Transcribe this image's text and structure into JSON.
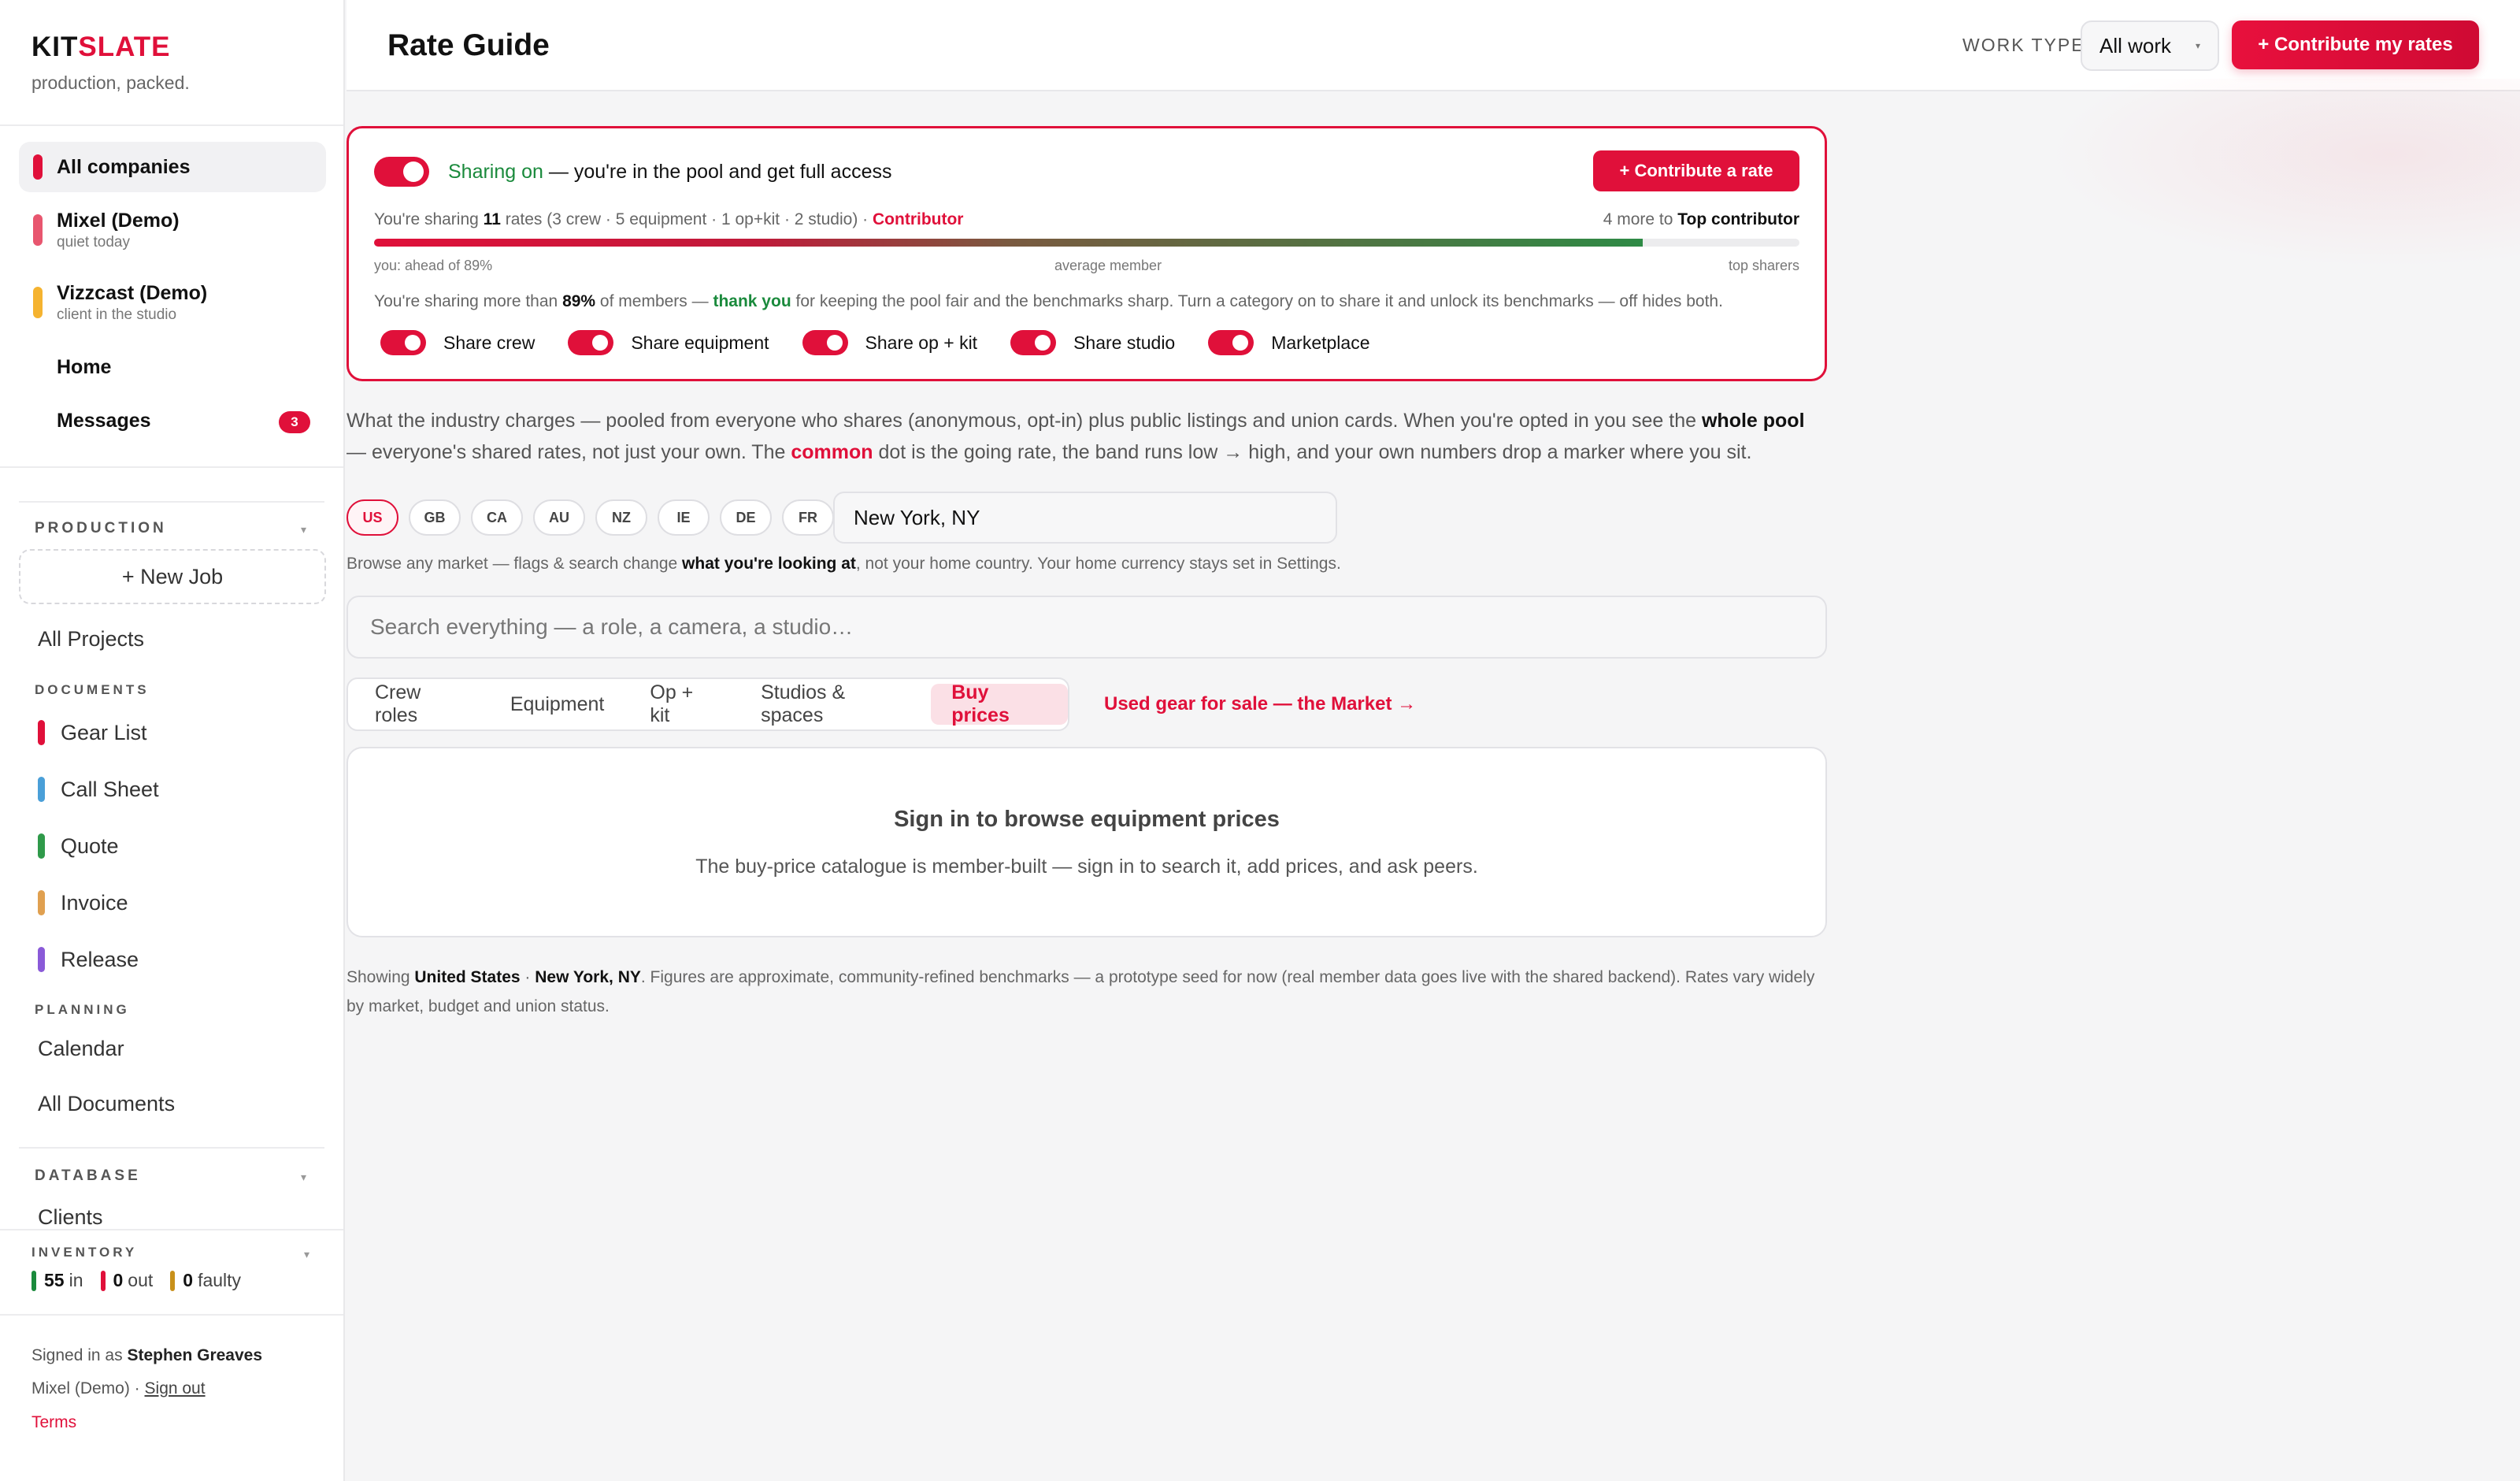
{
  "brand": {
    "kit": "KIT",
    "slate": "SLATE",
    "tagline": "production, packed."
  },
  "companies": [
    {
      "name": "All companies",
      "sub": "",
      "color": "#e0103a"
    },
    {
      "name": "Mixel (Demo)",
      "sub": "quiet today",
      "color": "#e8566f"
    },
    {
      "name": "Vizzcast (Demo)",
      "sub": "client in the studio",
      "color": "#f5b330"
    }
  ],
  "nav": {
    "home": "Home",
    "messages": "Messages",
    "messages_badge": "3"
  },
  "sections": {
    "production": "PRODUCTION",
    "new_job": "+ New Job",
    "all_projects": "All Projects",
    "documents": "DOCUMENTS",
    "planning": "PLANNING",
    "calendar": "Calendar",
    "all_documents": "All Documents",
    "database": "DATABASE",
    "clients": "Clients",
    "inventory": "INVENTORY"
  },
  "documents": [
    {
      "label": "Gear List",
      "color": "#e0103a"
    },
    {
      "label": "Call Sheet",
      "color": "#4a9fd8"
    },
    {
      "label": "Quote",
      "color": "#2f9a4a"
    },
    {
      "label": "Invoice",
      "color": "#e0a050"
    },
    {
      "label": "Release",
      "color": "#8a5ad8"
    }
  ],
  "inventory": {
    "in_count": "55",
    "in_label": "in",
    "in_color": "#1a8a3c",
    "out_count": "0",
    "out_label": "out",
    "out_color": "#e0103a",
    "faulty_count": "0",
    "faulty_label": "faulty",
    "faulty_color": "#c8901a"
  },
  "account": {
    "signed_prefix": "Signed in as",
    "user": "Stephen Greaves",
    "company": "Mixel (Demo)",
    "sep": " · ",
    "sign_out": "Sign out",
    "terms": "Terms"
  },
  "header": {
    "title": "Rate Guide",
    "work_type_label": "WORK TYPE",
    "work_type_value": "All work",
    "contribute_button": "+ Contribute my rates"
  },
  "sharing": {
    "status": "Sharing on",
    "status_rest": " — you're in the pool and get full access",
    "contribute_rate": "+ Contribute a rate",
    "sharing_prefix": "You're sharing ",
    "rates_count": "11",
    "sharing_detail": " rates (3 crew · 5 equipment · 1 op+kit · 2 studio) · ",
    "tier": "Contributor",
    "more_prefix": "4 more to ",
    "next_tier": "Top contributor",
    "progress_fraction": 0.89,
    "label_you": "you: ahead of 89%",
    "label_avg": "average member",
    "label_top": "top sharers",
    "note_prefix": "You're sharing more than ",
    "note_pct": "89%",
    "note_mid": " of members — ",
    "note_thanks": "thank you",
    "note_rest": " for keeping the pool fair and the benchmarks sharp. Turn a category on to share it and unlock its benchmarks — off hides both.",
    "toggles": [
      {
        "label": "Share crew",
        "on": true
      },
      {
        "label": "Share equipment",
        "on": true
      },
      {
        "label": "Share op + kit",
        "on": true
      },
      {
        "label": "Share studio",
        "on": true
      },
      {
        "label": "Marketplace",
        "on": true
      }
    ]
  },
  "intro": {
    "part1": "What the industry charges — pooled from everyone who shares (anonymous, opt-in) plus public listings and union cards. When you're opted in you see the ",
    "whole_pool": "whole pool",
    "part2": " — everyone's shared rates, not just your own. The ",
    "common": "common",
    "part3": " dot is the going rate, the band runs low → high, and your own numbers drop a marker where you sit."
  },
  "markets": [
    "US",
    "GB",
    "CA",
    "AU",
    "NZ",
    "IE",
    "DE",
    "FR"
  ],
  "selected_market": "US",
  "city": "New York, NY",
  "browse_note": {
    "prefix": "Browse any market — flags & search change ",
    "bold": "what you're looking at",
    "suffix": ", not your home country. Your home currency stays set in Settings."
  },
  "search": {
    "placeholder": "Search everything — a role, a camera, a studio…"
  },
  "tabs": [
    "Crew roles",
    "Equipment",
    "Op + kit",
    "Studios & spaces",
    "Buy prices"
  ],
  "active_tab": "Buy prices",
  "market_link": "Used gear for sale — the Market →",
  "signin": {
    "title": "Sign in to browse equipment prices",
    "subtitle": "The buy-price catalogue is member-built — sign in to search it, add prices, and ask peers."
  },
  "footer": {
    "prefix": "Showing ",
    "country": "United States",
    "sep": " · ",
    "city": "New York, NY",
    "rest": ". Figures are approximate, community-refined benchmarks — a prototype seed for now (real member data goes live with the shared backend). Rates vary widely by market, budget and union status."
  },
  "colors": {
    "accent": "#e0103a",
    "green": "#1a8a3c"
  }
}
